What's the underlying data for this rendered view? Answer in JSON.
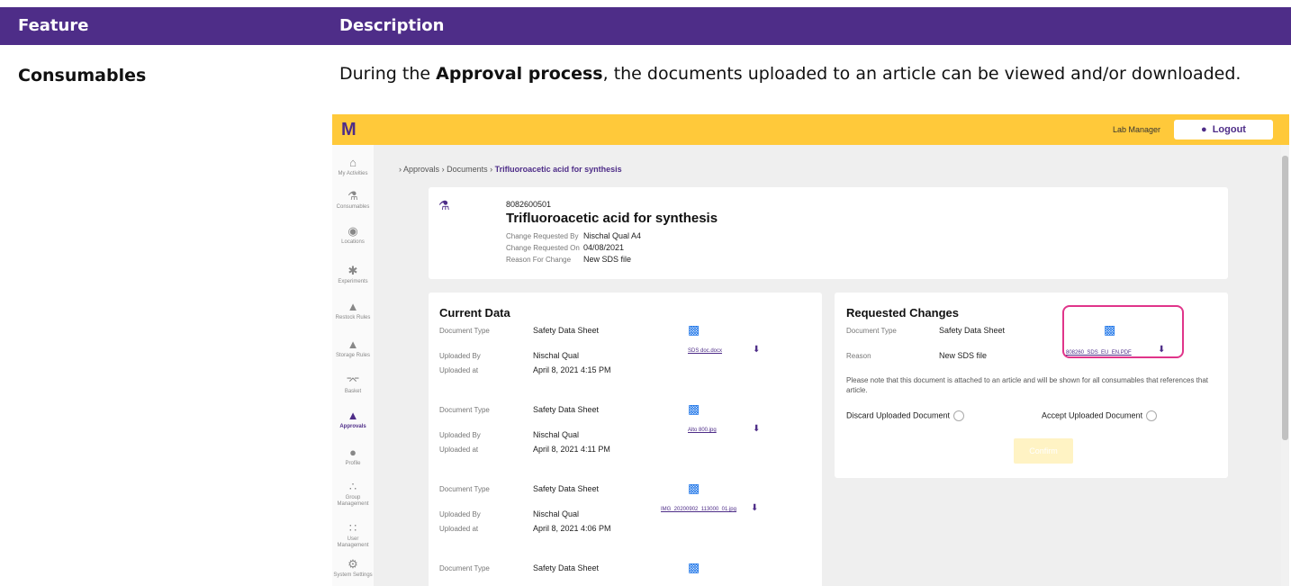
{
  "table": {
    "col_feature": "Feature",
    "col_description": "Description",
    "row_feature": "Consumables",
    "row_desc_pre": "During the ",
    "row_desc_bold": "Approval process",
    "row_desc_post": ", the documents uploaded to an article can be viewed and/or downloaded."
  },
  "app": {
    "logo": "M",
    "role": "Lab Manager",
    "logout_label": "Logout",
    "sidebar": [
      {
        "label": "My Activities",
        "icon": "home-icon"
      },
      {
        "label": "Consumables",
        "icon": "flask-icon"
      },
      {
        "label": "Locations",
        "icon": "pin-icon"
      },
      {
        "label": "Experiments",
        "icon": "molecule-icon"
      },
      {
        "label": "Restock Rules",
        "icon": "bell-icon"
      },
      {
        "label": "Storage Rules",
        "icon": "storage-icon"
      },
      {
        "label": "Basket",
        "icon": "basket-icon"
      },
      {
        "label": "Approvals",
        "icon": "thumbs-up-icon"
      },
      {
        "label": "Profile",
        "icon": "person-icon"
      },
      {
        "label": "Group Management",
        "icon": "group-icon"
      },
      {
        "label": "User Management",
        "icon": "users-icon"
      },
      {
        "label": "System Settings",
        "icon": "gear-icon"
      }
    ],
    "breadcrumb": {
      "c1": "Approvals",
      "c2": "Documents",
      "c3": "Trifluoroacetic acid for synthesis"
    },
    "article": {
      "number": "8082600501",
      "name": "Trifluoroacetic acid for synthesis",
      "req_by_label": "Change Requested By",
      "req_by": "Nischal Qual A4",
      "req_on_label": "Change Requested On",
      "req_on": "04/08/2021",
      "reason_label": "Reason For Change",
      "reason": "New SDS file"
    },
    "current": {
      "title": "Current Data",
      "doctype_label": "Document Type",
      "uploaded_by_label": "Uploaded By",
      "uploaded_at_label": "Uploaded at",
      "docs": [
        {
          "type": "Safety Data Sheet",
          "by": "Nischal Qual",
          "at": "April 8, 2021 4:15 PM",
          "file": "SDS doc.docx"
        },
        {
          "type": "Safety Data Sheet",
          "by": "Nischal Qual",
          "at": "April 8, 2021 4:11 PM",
          "file": "Alto 800.jpg"
        },
        {
          "type": "Safety Data Sheet",
          "by": "Nischal Qual",
          "at": "April 8, 2021 4:06 PM",
          "file": "IMG_20200902_113000_01.jpg"
        },
        {
          "type": "Safety Data Sheet"
        }
      ]
    },
    "requested": {
      "title": "Requested Changes",
      "doctype_label": "Document Type",
      "doctype": "Safety Data Sheet",
      "reason_label": "Reason",
      "reason": "New SDS file",
      "file": "808260_SDS_EU_EN.PDF",
      "note": "Please note that this document is attached to an article and will be shown for all consumables that references that article.",
      "discard_label": "Discard Uploaded Document",
      "accept_label": "Accept Uploaded Document",
      "confirm_label": "Confirm"
    }
  }
}
